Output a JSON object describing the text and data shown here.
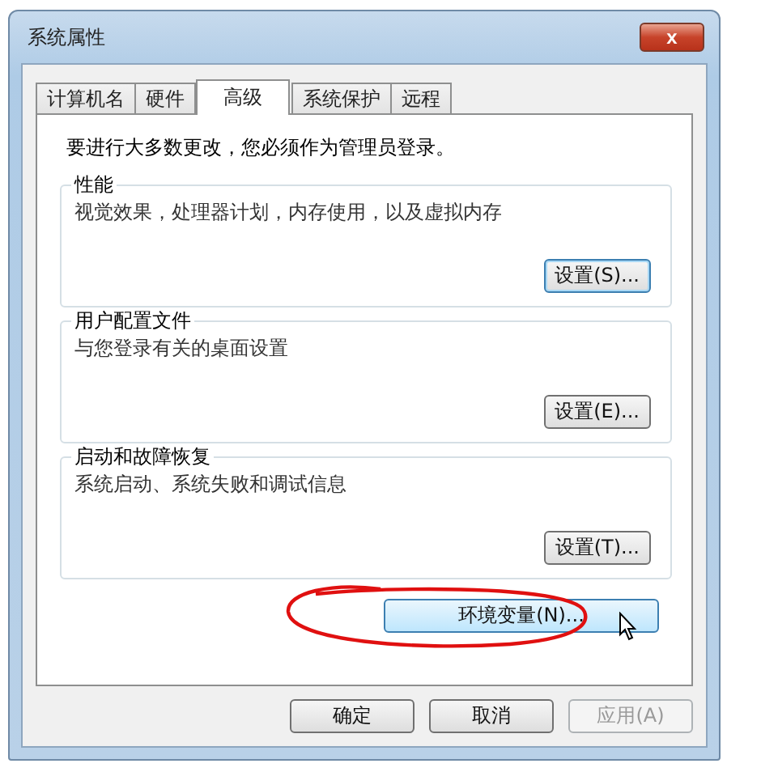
{
  "window": {
    "title": "系统属性",
    "close": "x"
  },
  "tabs": [
    {
      "label": "计算机名",
      "selected": false
    },
    {
      "label": "硬件",
      "selected": false
    },
    {
      "label": "高级",
      "selected": true
    },
    {
      "label": "系统保护",
      "selected": false
    },
    {
      "label": "远程",
      "selected": false
    }
  ],
  "notice": "要进行大多数更改，您必须作为管理员登录。",
  "groups": [
    {
      "title": "性能",
      "description": "视觉效果，处理器计划，内存使用，以及虚拟内存",
      "button": {
        "label": "设置(S)...",
        "focused": true
      }
    },
    {
      "title": "用户配置文件",
      "description": "与您登录有关的桌面设置",
      "button": {
        "label": "设置(E)...",
        "focused": false
      }
    },
    {
      "title": "启动和故障恢复",
      "description": "系统启动、系统失败和调试信息",
      "button": {
        "label": "设置(T)...",
        "focused": false
      }
    }
  ],
  "environment_button": {
    "label": "环境变量(N)...",
    "hovered": true
  },
  "buttons": [
    {
      "label": "确定",
      "disabled": false
    },
    {
      "label": "取消",
      "disabled": false
    },
    {
      "label": "应用(A)",
      "disabled": true
    }
  ]
}
